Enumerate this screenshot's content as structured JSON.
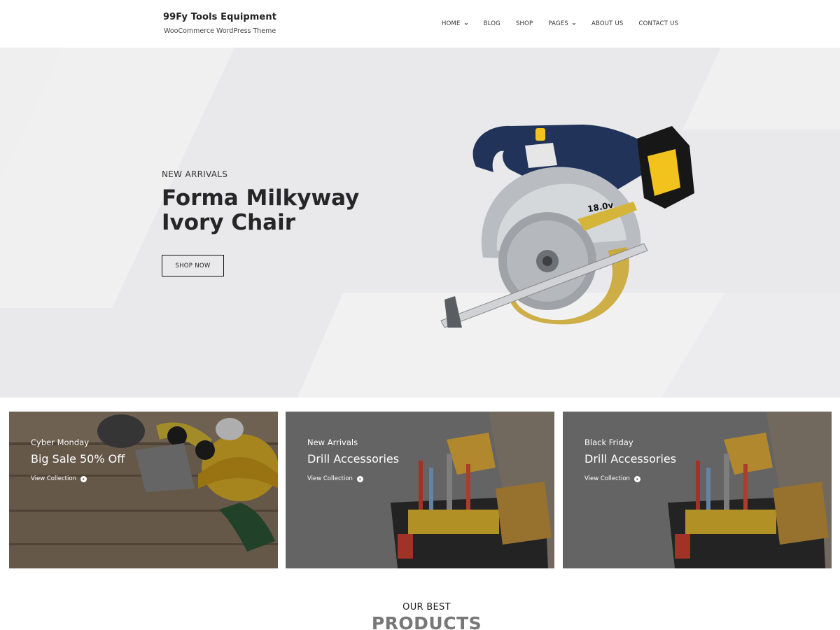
{
  "header": {
    "site_title": "99Fy Tools Equipment",
    "tagline": "WooCommerce WordPress Theme",
    "nav": [
      {
        "label": "HOME",
        "has_dropdown": true
      },
      {
        "label": "BLOG",
        "has_dropdown": false
      },
      {
        "label": "SHOP",
        "has_dropdown": false
      },
      {
        "label": "PAGES",
        "has_dropdown": true
      },
      {
        "label": "ABOUT US",
        "has_dropdown": false
      },
      {
        "label": "CONTACT US",
        "has_dropdown": false
      }
    ]
  },
  "hero": {
    "eyebrow": "NEW ARRIVALS",
    "title_line1": "Forma Milkyway",
    "title_line2": "Ivory Chair",
    "button_label": "SHOP NOW",
    "image_icon": "circular-saw-image",
    "saw_label": "18.0v"
  },
  "cards": [
    {
      "subtitle": "Cyber Monday",
      "title": "Big Sale 50% Off",
      "link": "View Collection",
      "image_icon": "safety-gear-image"
    },
    {
      "subtitle": "New Arrivals",
      "title": "Drill Accessories",
      "link": "View Collection",
      "image_icon": "tool-belt-image"
    },
    {
      "subtitle": "Black Friday",
      "title": "Drill Accessories",
      "link": "View Collection",
      "image_icon": "tool-belt-image"
    }
  ],
  "section": {
    "subtitle": "OUR BEST",
    "title": "PRODUCTS"
  },
  "colors": {
    "hero_bg": "#e9e9eb",
    "text_dark": "#222222",
    "card_overlay": "#6b6b6b"
  }
}
